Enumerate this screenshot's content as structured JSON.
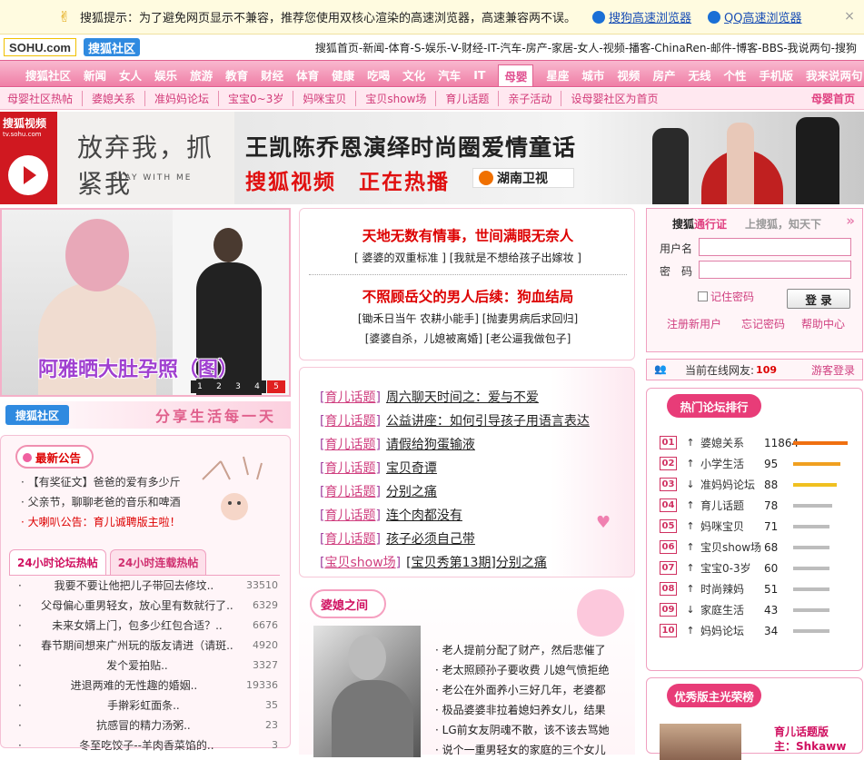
{
  "notice": {
    "text": "搜狐提示：为了避免网页显示不兼容，推荐您使用双核心渲染的高速浏览器，高速兼容两不误。",
    "link1": "搜狗高速浏览器",
    "link2": "QQ高速浏览器",
    "close": "×"
  },
  "logos": {
    "sohu": "SOHU.com",
    "shequ": "搜狐社区"
  },
  "toplinks": "搜狐首页-新闻-体育-S-娱乐-V-财经-IT-汽车-房产-家居-女人-视频-播客-ChinaRen-邮件-博客-BBS-我说两句-搜狗",
  "channels": [
    "搜狐社区",
    "新闻",
    "女人",
    "娱乐",
    "旅游",
    "教育",
    "财经",
    "体育",
    "健康",
    "吃喝",
    "文化",
    "汽车",
    "IT",
    "母婴",
    "星座",
    "城市",
    "视频",
    "房产",
    "无线",
    "个性",
    "手机版",
    "我来说两句"
  ],
  "active_channel": "母婴",
  "subnav": [
    "母婴社区热帖",
    "婆媳关系",
    "准妈妈论坛",
    "宝宝0~3岁",
    "妈咪宝贝",
    "宝贝show场",
    "育儿话题",
    "亲子活动",
    "设母婴社区为首页"
  ],
  "subnav_home": "母婴首页",
  "banner": {
    "tv_name": "搜狐视频",
    "tv_url": "tv.sohu.com",
    "title_art": "放弃我，抓紧我",
    "title_en": "STAY WITH ME",
    "headline": "王凯陈乔恩演绎时尚圈爱情童话",
    "sub": "搜狐视频　正在热播",
    "station": "湖南卫视"
  },
  "photo": {
    "caption": "阿雅晒大肚孕照（图）",
    "pages": [
      "1",
      "2",
      "3",
      "4",
      "5"
    ]
  },
  "shequ_slogan": "分享生活每一天",
  "announce": {
    "title": "最新公告",
    "items": [
      {
        "text": "【有奖征文】爸爸的爱有多少斤",
        "red": false
      },
      {
        "text": "父亲节，聊聊老爸的音乐和啤酒",
        "red": false
      },
      {
        "text": "大喇叭公告：育儿诚聘版主啦！",
        "red": true
      }
    ]
  },
  "tabs": [
    "24小时论坛热帖",
    "24小时连载热帖"
  ],
  "hot": [
    {
      "title": "我要不要让他把儿子带回去修坟..",
      "n": "33510"
    },
    {
      "title": "父母偏心重男轻女，放心里有数就行了..",
      "n": "6329"
    },
    {
      "title": "未来女婿上门，包多少红包合适？..",
      "n": "6676"
    },
    {
      "title": "春节期间想来广州玩的版友请进（请斑..",
      "n": "4920"
    },
    {
      "title": "发个爱拍贴..",
      "n": "3327"
    },
    {
      "title": "进退两难的无性趣的婚姻..",
      "n": "19336"
    },
    {
      "title": "手擀彩虹面条..",
      "n": "35"
    },
    {
      "title": "抗感冒的精力汤粥..",
      "n": "23"
    },
    {
      "title": "冬至吃饺子--羊肉香菜馅的..",
      "n": "3"
    }
  ],
  "feature": {
    "h1": "天地无数有情事，世间满眼无奈人",
    "l1": "[ 婆婆的双重标准 ] [我就是不想给孩子出嫁妆 ]",
    "h2": "不照顾岳父的男人后续：狗血结局",
    "l2": "[锄禾日当午 农耕小能手] [抛妻男病后求回归]",
    "l3": "[婆婆自杀，儿媳被离婚] [老公逼我做包子]"
  },
  "topics": [
    {
      "tag": "育儿话题",
      "text": "周六聊天时间之：爱与不爱"
    },
    {
      "tag": "育儿话题",
      "text": "公益讲座：如何引导孩子用语言表达"
    },
    {
      "tag": "育儿话题",
      "text": "请假给狗蛋输液"
    },
    {
      "tag": "育儿话题",
      "text": "宝贝奇谭"
    },
    {
      "tag": "育儿话题",
      "text": "分别之痛"
    },
    {
      "tag": "育儿话题",
      "text": "连个肉都没有"
    },
    {
      "tag": "育儿话题",
      "text": "孩子必须自己带"
    },
    {
      "tag": "宝贝show场",
      "text": "[宝贝秀第13期]分别之痛"
    }
  ],
  "popo": {
    "title": "婆媳之间",
    "items": [
      "老人提前分配了财产，然后悲催了",
      "老太照顾孙子要收费 儿媳气愤拒绝",
      "老公在外面养小三好几年，老婆都",
      "极品婆婆非拉着媳妇养女儿，结果",
      "LG前女友阴魂不散，该不该去骂她",
      "说个一重男轻女的家庭的三个女儿"
    ]
  },
  "login": {
    "brand_a": "搜狐",
    "brand_b": "通行证",
    "slogan": "上搜狐，知天下",
    "arrow": "»",
    "user_label": "用户名",
    "pass_label": "密　码",
    "remember": "记住密码",
    "submit": "登 录",
    "register": "注册新用户",
    "forgot": "忘记密码",
    "help": "帮助中心"
  },
  "online": {
    "label": "当前在线网友:",
    "count": "109",
    "guest": "游客登录"
  },
  "rank": {
    "title": "热门论坛排行",
    "items": [
      {
        "num": "01",
        "dir": "up",
        "name": "婆媳关系",
        "value": 11864,
        "color": "#f07010"
      },
      {
        "num": "02",
        "dir": "up",
        "name": "小学生活",
        "value": 95,
        "color": "#f0a020"
      },
      {
        "num": "03",
        "dir": "down",
        "name": "准妈妈论坛",
        "value": 88,
        "color": "#f0c020"
      },
      {
        "num": "04",
        "dir": "up",
        "name": "育儿话题",
        "value": 78,
        "color": "#bdbdbd"
      },
      {
        "num": "05",
        "dir": "up",
        "name": "妈咪宝贝",
        "value": 71,
        "color": "#bdbdbd"
      },
      {
        "num": "06",
        "dir": "up",
        "name": "宝贝show场",
        "value": 68,
        "color": "#bdbdbd"
      },
      {
        "num": "07",
        "dir": "up",
        "name": "宝宝0-3岁",
        "value": 60,
        "color": "#bdbdbd"
      },
      {
        "num": "08",
        "dir": "up",
        "name": "时尚辣妈",
        "value": 51,
        "color": "#bdbdbd"
      },
      {
        "num": "09",
        "dir": "down",
        "name": "家庭生活",
        "value": 43,
        "color": "#bdbdbd"
      },
      {
        "num": "10",
        "dir": "up",
        "name": "妈妈论坛",
        "value": 34,
        "color": "#bdbdbd"
      }
    ]
  },
  "star": {
    "title": "优秀版主光荣榜",
    "board": "育儿话题版",
    "host": "主：Shkaww"
  },
  "colors": {
    "pink": "#ef7fa6",
    "red": "#d00000",
    "link": "#1a4fb5"
  }
}
